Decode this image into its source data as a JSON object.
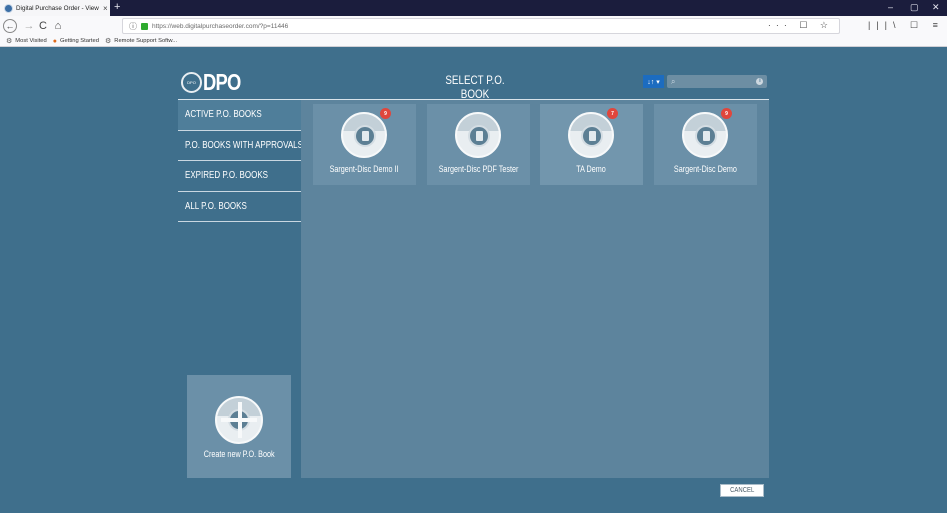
{
  "browser": {
    "tab_title": "Digital Purchase Order - View",
    "tab_close": "×",
    "new_tab": "+",
    "url": "https://web.digitalpurchaseorder.com/?p=11446",
    "url_tools": "··· ☐ ☆",
    "right_tools": "|||\\ ☐ ≡",
    "window_controls": {
      "minimize": "–",
      "maximize": "▢",
      "close": "✕"
    },
    "nav": {
      "back": "←",
      "forward": "→",
      "reload": "C",
      "home": "⌂"
    },
    "bookmarks": [
      {
        "label": "Most Visited",
        "icon": "⚙"
      },
      {
        "label": "Getting Started",
        "icon": "●"
      },
      {
        "label": "Remote Support Softw...",
        "icon": "⚙"
      }
    ]
  },
  "app": {
    "logo_text": "DPO",
    "logo_seal_text": "DPO",
    "title": "SELECT P.O. BOOK",
    "sort_label": "↓↑ ▾",
    "search": {
      "placeholder": "",
      "icon": "⌕",
      "info": "i"
    },
    "sidebar": [
      {
        "label": "ACTIVE P.O. BOOKS",
        "active": true
      },
      {
        "label": "P.O. BOOKS WITH APPROVALS",
        "active": false
      },
      {
        "label": "EXPIRED P.O. BOOKS",
        "active": false
      },
      {
        "label": "ALL P.O. BOOKS",
        "active": false
      }
    ],
    "books": [
      {
        "name": "Sargent-Disc Demo II",
        "badge": "9"
      },
      {
        "name": "Sargent-Disc PDF Tester",
        "badge": ""
      },
      {
        "name": "TA Demo",
        "badge": "7"
      },
      {
        "name": "Sargent-Disc Demo",
        "badge": "9"
      }
    ],
    "create_label": "Create new P.O. Book",
    "cancel_label": "CANCEL"
  }
}
